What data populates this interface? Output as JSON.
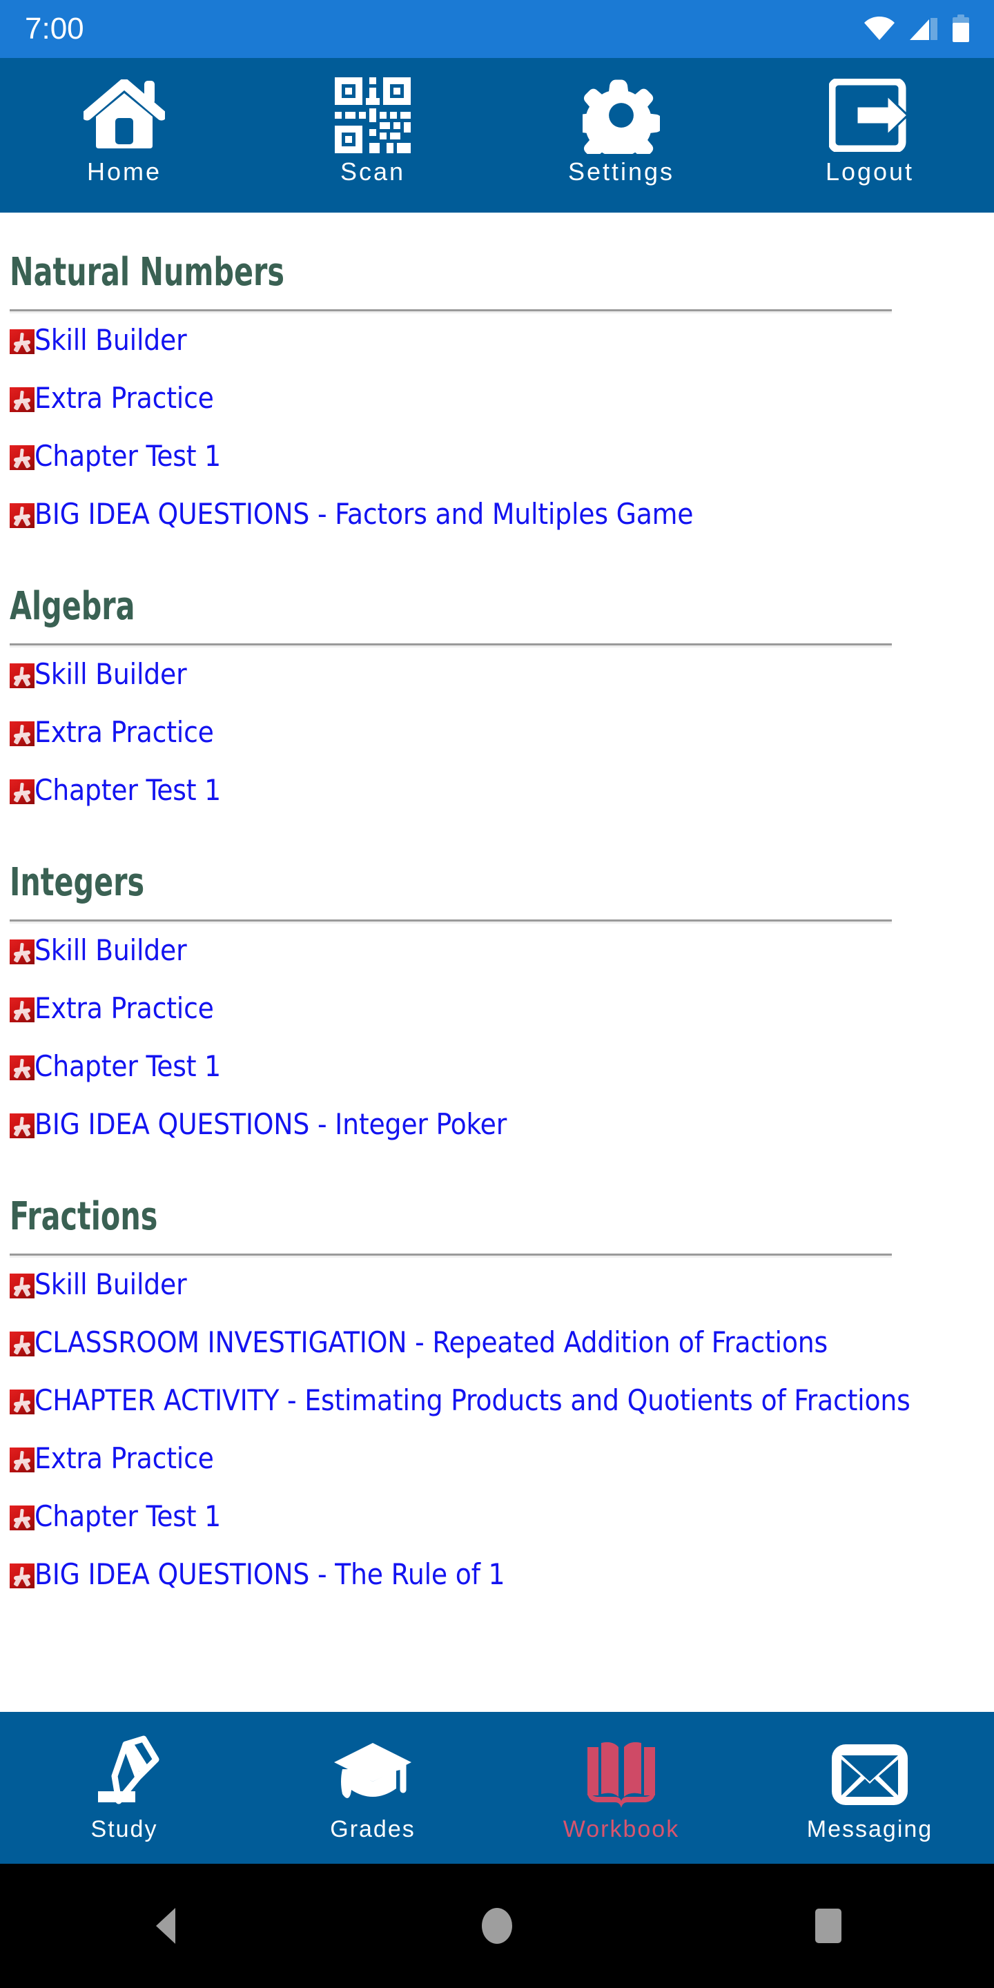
{
  "status_bar": {
    "time": "7:00",
    "icons": [
      "wifi-icon",
      "cellular-signal-icon",
      "battery-icon"
    ],
    "background": "#1b7ad4"
  },
  "top_nav": {
    "background": "#015c98",
    "items": [
      {
        "label": "Home",
        "icon": "home-icon"
      },
      {
        "label": "Scan",
        "icon": "qr-code-icon"
      },
      {
        "label": "Settings",
        "icon": "gear-icon"
      },
      {
        "label": "Logout",
        "icon": "logout-icon"
      }
    ]
  },
  "content": {
    "heading_color": "#3a6153",
    "link_color": "#1313f0",
    "sections": [
      {
        "title": "Natural Numbers",
        "resources": [
          {
            "icon": "pdf-icon",
            "label": "Skill Builder"
          },
          {
            "icon": "pdf-icon",
            "label": "Extra Practice"
          },
          {
            "icon": "pdf-icon",
            "label": "Chapter Test 1"
          },
          {
            "icon": "pdf-icon",
            "label": "BIG IDEA QUESTIONS - Factors and Multiples Game"
          }
        ]
      },
      {
        "title": "Algebra",
        "resources": [
          {
            "icon": "pdf-icon",
            "label": "Skill Builder"
          },
          {
            "icon": "pdf-icon",
            "label": "Extra Practice"
          },
          {
            "icon": "pdf-icon",
            "label": "Chapter Test 1"
          }
        ]
      },
      {
        "title": "Integers",
        "resources": [
          {
            "icon": "pdf-icon",
            "label": "Skill Builder"
          },
          {
            "icon": "pdf-icon",
            "label": "Extra Practice"
          },
          {
            "icon": "pdf-icon",
            "label": "Chapter Test 1"
          },
          {
            "icon": "pdf-icon",
            "label": "BIG IDEA QUESTIONS - Integer Poker"
          }
        ]
      },
      {
        "title": "Fractions",
        "resources": [
          {
            "icon": "pdf-icon",
            "label": "Skill Builder"
          },
          {
            "icon": "pdf-icon",
            "label": "CLASSROOM INVESTIGATION - Repeated Addition of Fractions"
          },
          {
            "icon": "pdf-icon",
            "label": "CHAPTER ACTIVITY - Estimating Products and Quotients of Fractions"
          },
          {
            "icon": "pdf-icon",
            "label": "Extra Practice"
          },
          {
            "icon": "pdf-icon",
            "label": "Chapter Test 1"
          },
          {
            "icon": "pdf-icon",
            "label": "BIG IDEA QUESTIONS - The Rule of 1"
          }
        ]
      }
    ]
  },
  "bottom_nav": {
    "background": "#015c98",
    "active_color": "#d9556e",
    "items": [
      {
        "label": "Study",
        "icon": "pencil-icon",
        "active": false
      },
      {
        "label": "Grades",
        "icon": "graduation-cap-icon",
        "active": false
      },
      {
        "label": "Workbook",
        "icon": "open-book-icon",
        "active": true
      },
      {
        "label": "Messaging",
        "icon": "envelope-icon",
        "active": false
      }
    ]
  },
  "system_nav": {
    "background": "#000000",
    "buttons": [
      {
        "name": "back-button",
        "icon": "triangle-back-icon"
      },
      {
        "name": "home-button",
        "icon": "circle-home-icon"
      },
      {
        "name": "recents-button",
        "icon": "square-recents-icon"
      }
    ]
  }
}
